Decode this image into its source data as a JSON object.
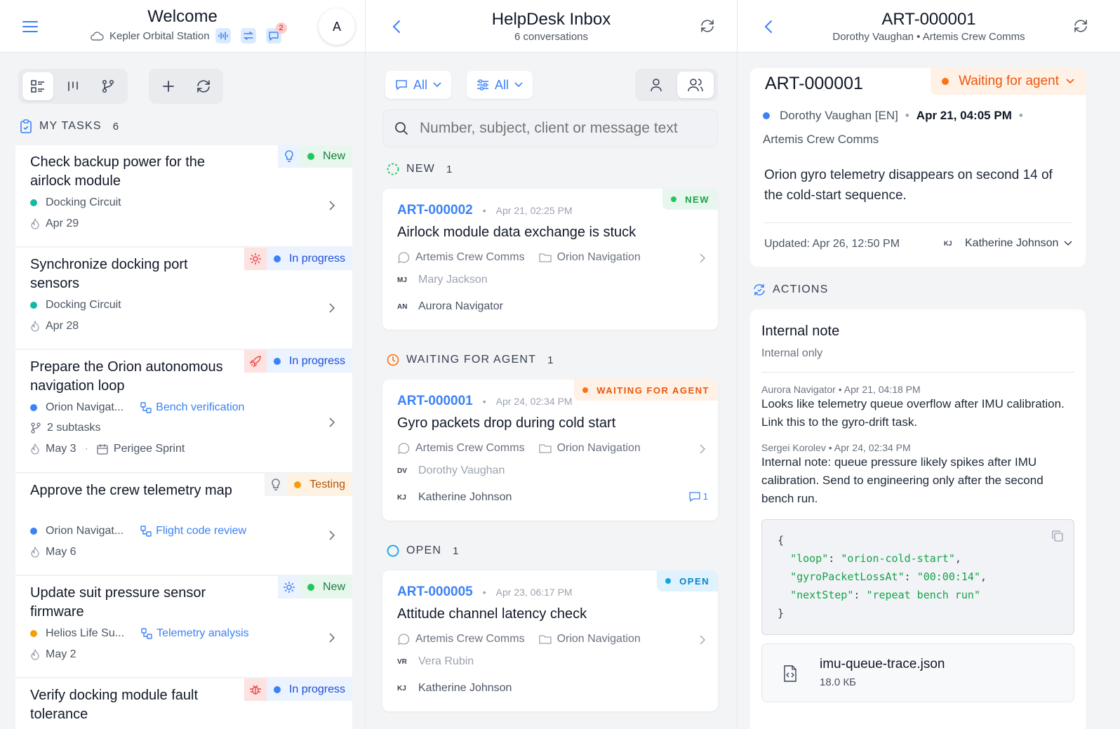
{
  "left": {
    "title": "Welcome",
    "station": "Kepler Orbital Station",
    "chat_badge": "2",
    "avatar": "A",
    "section_label": "MY TASKS",
    "section_count": "6",
    "tasks": [
      {
        "title": "Check backup power for the airlock module",
        "project": "Docking Circuit",
        "due": "Apr 29",
        "status": "New"
      },
      {
        "title": "Synchronize docking port sensors",
        "project": "Docking Circuit",
        "due": "Apr 28",
        "status": "In progress"
      },
      {
        "title": "Prepare the Orion autonomous navigation loop",
        "project": "Orion Navigat...",
        "link": "Bench verification",
        "subtasks": "2 subtasks",
        "due": "May 3",
        "sprint": "Perigee Sprint",
        "status": "In progress"
      },
      {
        "title": "Approve the crew telemetry map",
        "project": "Orion Navigat...",
        "link": "Flight code review",
        "due": "May 6",
        "status": "Testing"
      },
      {
        "title": "Update suit pressure sensor firmware",
        "project": "Helios Life Su...",
        "link": "Telemetry analysis",
        "due": "May 2",
        "status": "New"
      },
      {
        "title": "Verify docking module fault tolerance",
        "status": "In progress"
      }
    ]
  },
  "inbox": {
    "title": "HelpDesk Inbox",
    "subtitle": "6 conversations",
    "filter1": "All",
    "filter2": "All",
    "search_placeholder": "Number, subject, client or message text",
    "groups": [
      {
        "label": "NEW",
        "count": "1"
      },
      {
        "label": "WAITING FOR AGENT",
        "count": "1"
      },
      {
        "label": "OPEN",
        "count": "1"
      }
    ],
    "conversations": [
      {
        "id": "ART-000002",
        "date": "Apr 21, 02:25 PM",
        "tag": "NEW",
        "subject": "Airlock module data exchange is stuck",
        "channel": "Artemis Crew Comms",
        "folder": "Orion Navigation",
        "client_initials": "MJ",
        "client": "Mary Jackson",
        "agent_initials": "AN",
        "agent": "Aurora Navigator"
      },
      {
        "id": "ART-000001",
        "date": "Apr 24, 02:34 PM",
        "tag": "WAITING FOR AGENT",
        "subject": "Gyro packets drop during cold start",
        "channel": "Artemis Crew Comms",
        "folder": "Orion Navigation",
        "client_initials": "DV",
        "client": "Dorothy Vaughan",
        "agent_initials": "KJ",
        "agent": "Katherine Johnson",
        "comments": "1"
      },
      {
        "id": "ART-000005",
        "date": "Apr 23, 06:17 PM",
        "tag": "OPEN",
        "subject": "Attitude channel latency check",
        "channel": "Artemis Crew Comms",
        "folder": "Orion Navigation",
        "client_initials": "VR",
        "client": "Vera Rubin",
        "agent_initials": "KJ",
        "agent": "Katherine Johnson"
      }
    ]
  },
  "detail": {
    "title": "ART-000001",
    "subtitle": "Dorothy Vaughan • Artemis Crew Comms",
    "card_id": "ART-000001",
    "status": "Waiting for agent",
    "client": "Dorothy Vaughan [EN]",
    "date": "Apr 21, 04:05 PM",
    "channel": "Artemis Crew Comms",
    "message": "Orion gyro telemetry disappears on second 14 of the cold-start sequence.",
    "updated": "Updated: Apr 26, 12:50 PM",
    "assignee_initials": "KJ",
    "assignee": "Katherine Johnson",
    "actions_label": "ACTIONS",
    "note_title": "Internal note",
    "note_sub": "Internal only",
    "notes": [
      {
        "author": "Aurora Navigator • Apr 21, 04:18 PM",
        "text": "Looks like telemetry queue overflow after IMU calibration. Link this to the gyro-drift task."
      },
      {
        "author": "Sergei Korolev • Apr 24, 02:34 PM",
        "text": "Internal note: queue pressure likely spikes after IMU calibration. Send to engineering only after the second bench run."
      }
    ],
    "code": {
      "open": "{",
      "k1": "\"loop\"",
      "v1": "\"orion-cold-start\"",
      "k2": "\"gyroPacketLossAt\"",
      "v2": "\"00:00:14\"",
      "k3": "\"nextStep\"",
      "v3": "\"repeat bench run\"",
      "close": "}"
    },
    "file_name": "imu-queue-trace.json",
    "file_size": "18.0 КБ"
  },
  "colors": {
    "accent": "#3b82f6",
    "new": "#22c55e",
    "progress": "#3b82f6",
    "testing": "#f59e0b",
    "waiting": "#f97316",
    "open": "#0ea5e9",
    "teal": "#14b8a6"
  }
}
